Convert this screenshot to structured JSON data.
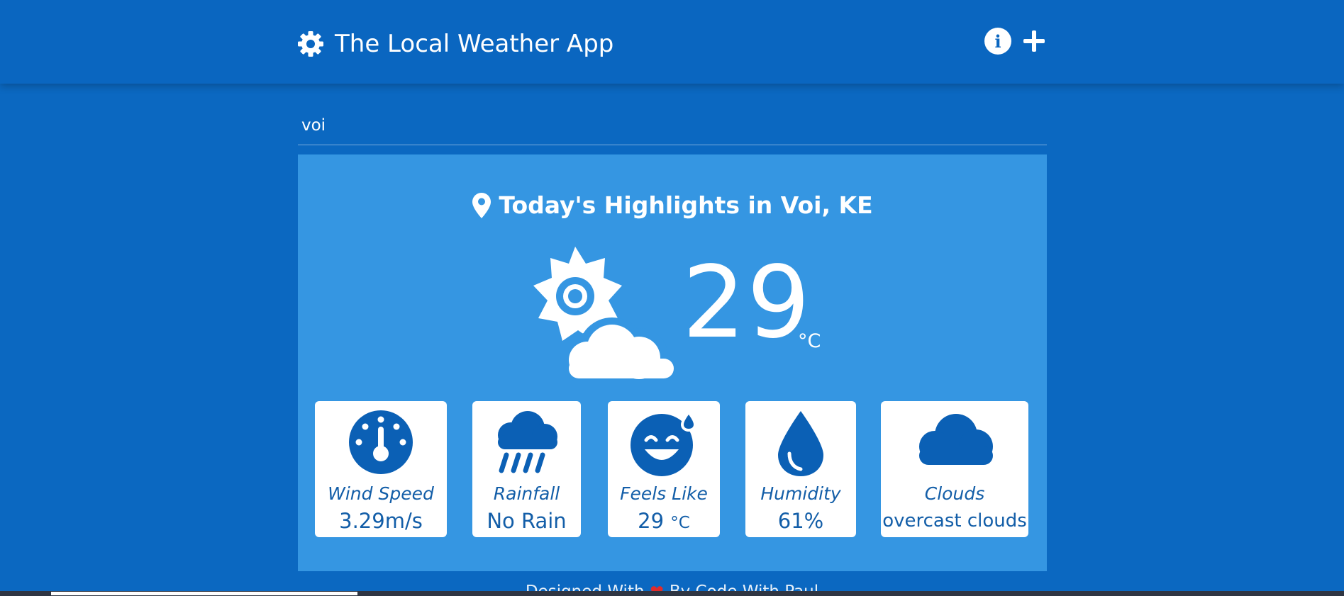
{
  "app": {
    "title": "The Local Weather App",
    "icons": {
      "logo": "gear-icon",
      "info": "info-icon",
      "add": "plus-icon"
    }
  },
  "search": {
    "value": "voi"
  },
  "highlights": {
    "title": "Today's Highlights in Voi, KE",
    "location_icon": "map-pin-icon",
    "condition_icon": "sun-behind-cloud-icon",
    "temperature": "29",
    "unit": "°C"
  },
  "stats": [
    {
      "label": "Wind Speed",
      "value": "3.29m/s",
      "icon": "gauge-icon"
    },
    {
      "label": "Rainfall",
      "value": "No Rain",
      "icon": "rain-cloud-icon"
    },
    {
      "label": "Feels Like",
      "value": "29",
      "unit": "°C",
      "icon": "sweat-smile-icon"
    },
    {
      "label": "Humidity",
      "value": "61%",
      "icon": "water-drop-icon"
    },
    {
      "label": "Clouds",
      "value": "overcast clouds",
      "icon": "cloud-icon"
    }
  ],
  "footer": {
    "text_start": "Designed With",
    "text_end": "By Code With Paul"
  },
  "colors": {
    "background": "#0b68c1",
    "card": "#3596e2",
    "accent": "#0b60b5",
    "heart": "#e02b2b"
  }
}
